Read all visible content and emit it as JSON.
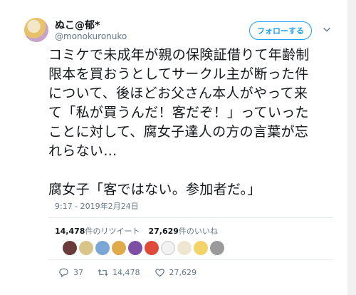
{
  "user": {
    "display_name": "ぬこ@郁*",
    "handle": "@monokuronuko"
  },
  "follow_label": "フォローする",
  "tweet": {
    "text": "コミケで未成年が親の保険証借りて年齢制限本を買おうとしてサークル主が断った件について、後ほどお父さん本人がやって来て「私が買うんだ！客だぞ！」っていったことに対して、腐女子達人の方の言葉が忘れらない…\n\n腐女子「客ではない。参加者だ。」",
    "timestamp": "9:17 - 2019年2月24日"
  },
  "stats": {
    "retweets_count": "14,478",
    "retweets_label": "件のリツイート",
    "likes_count": "27,629",
    "likes_label": "件のいいね"
  },
  "actions": {
    "reply_count": "37",
    "retweet_count": "14,478",
    "like_count": "27,629"
  },
  "icons": {
    "chevron": "chevron-down-icon",
    "reply": "reply-icon",
    "retweet": "retweet-icon",
    "like": "heart-icon"
  },
  "colors": {
    "accent": "#1da1f2",
    "secondary_text": "#657786",
    "primary_text": "#14171a"
  }
}
